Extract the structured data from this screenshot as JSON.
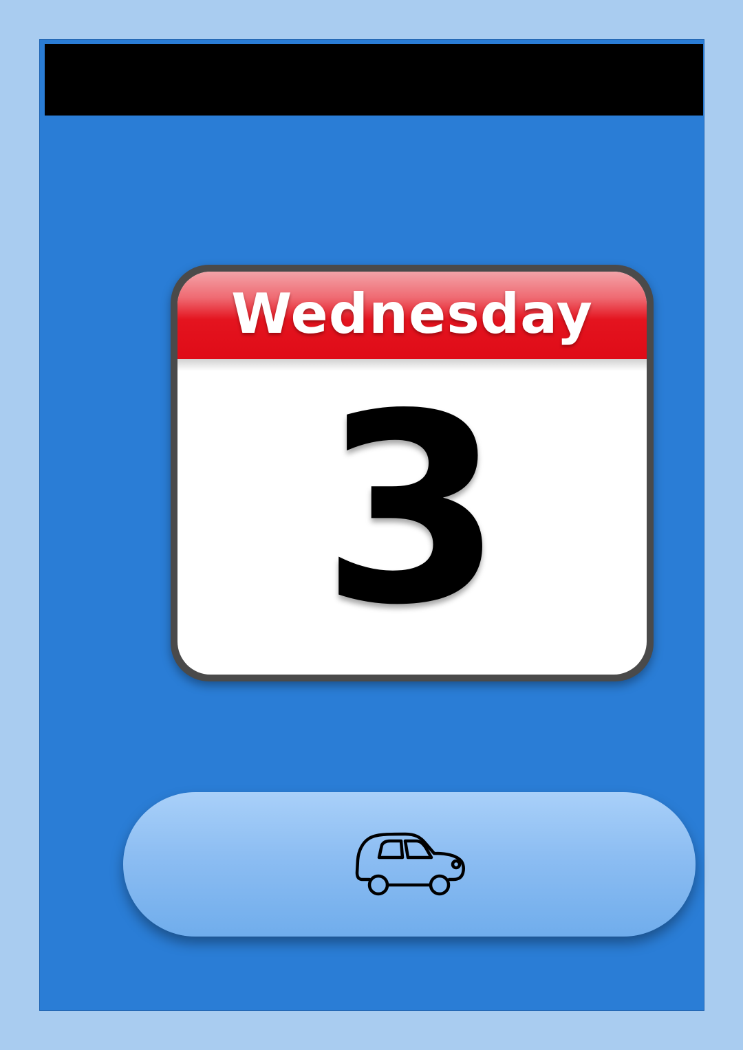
{
  "calendar": {
    "weekday": "Wednesday",
    "day": "3"
  },
  "action_button": {
    "icon": "car-icon"
  },
  "colors": {
    "page_background": "#a9ccf0",
    "screen_background": "#2a7dd6",
    "top_bar": "#000000",
    "calendar_header": "#df0b17",
    "button": "#8cbdf2"
  }
}
